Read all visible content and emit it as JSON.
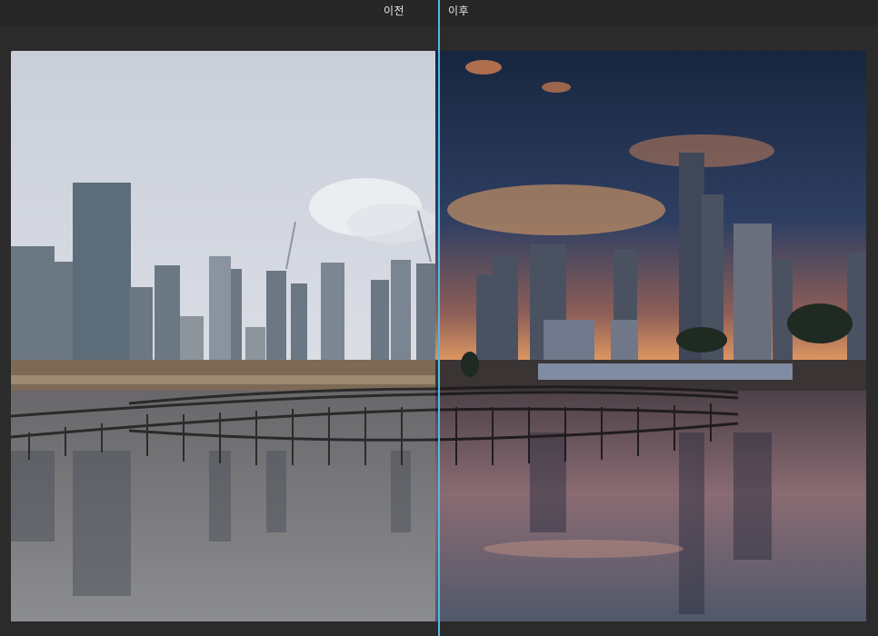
{
  "compare": {
    "before_label": "이전",
    "after_label": "이후",
    "split_position": 0.5
  },
  "colors": {
    "divider": "#4fb8e6",
    "app_background": "#262626"
  }
}
